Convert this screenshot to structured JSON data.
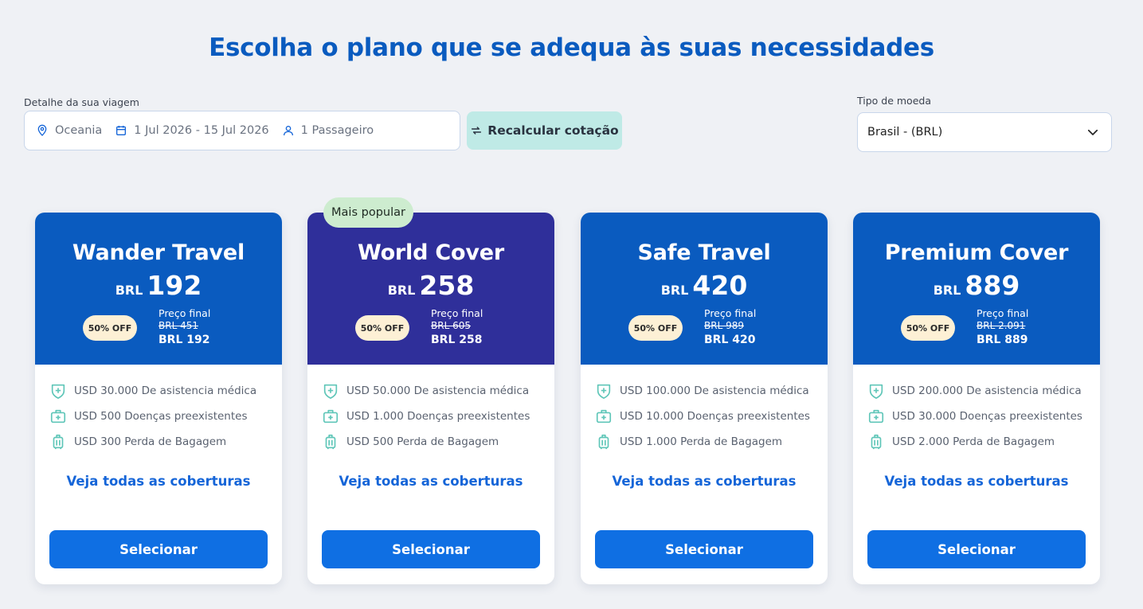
{
  "page": {
    "title": "Escolha o plano que se adequa às suas necessidades"
  },
  "trip": {
    "label": "Detalhe da sua viagem",
    "destination": "Oceania",
    "dates": "1 Jul 2026 - 15 Jul 2026",
    "passengers": "1 Passageiro",
    "recalc_label": "Recalcular cotação"
  },
  "currency": {
    "label": "Tipo de moeda",
    "selected": "Brasil - (BRL)"
  },
  "colors": {
    "blue_header": "#0a5bbf",
    "popular_header": "#2f2f9a",
    "button": "#0f6fe3",
    "recalc_bg": "#bfeae6",
    "icon_teal": "#5fc6b8"
  },
  "plans": [
    {
      "name": "Wander Travel",
      "currency": "BRL",
      "price": "192",
      "discount": "50% OFF",
      "final_label": "Preço final",
      "old_price": "BRL 451",
      "final_price": "BRL 192",
      "covers": [
        "USD 30.000 De asistencia médica",
        "USD 500 Doenças preexistentes",
        "USD 300 Perda de Bagagem"
      ],
      "see_all": "Veja todas as coberturas",
      "select": "Selecionar"
    },
    {
      "name": "World Cover",
      "currency": "BRL",
      "price": "258",
      "popular": "Mais popular",
      "discount": "50% OFF",
      "final_label": "Preço final",
      "old_price": "BRL 605",
      "final_price": "BRL 258",
      "covers": [
        "USD 50.000 De asistencia médica",
        "USD 1.000 Doenças preexistentes",
        "USD 500 Perda de Bagagem"
      ],
      "see_all": "Veja todas as coberturas",
      "select": "Selecionar"
    },
    {
      "name": "Safe Travel",
      "currency": "BRL",
      "price": "420",
      "discount": "50% OFF",
      "final_label": "Preço final",
      "old_price": "BRL 989",
      "final_price": "BRL 420",
      "covers": [
        "USD 100.000 De asistencia médica",
        "USD 10.000 Doenças preexistentes",
        "USD 1.000 Perda de Bagagem"
      ],
      "see_all": "Veja todas as coberturas",
      "select": "Selecionar"
    },
    {
      "name": "Premium Cover",
      "currency": "BRL",
      "price": "889",
      "discount": "50% OFF",
      "final_label": "Preço final",
      "old_price": "BRL 2.091",
      "final_price": "BRL 889",
      "covers": [
        "USD 200.000 De asistencia médica",
        "USD 30.000 Doenças preexistentes",
        "USD 2.000 Perda de Bagagem"
      ],
      "see_all": "Veja todas as coberturas",
      "select": "Selecionar"
    }
  ]
}
